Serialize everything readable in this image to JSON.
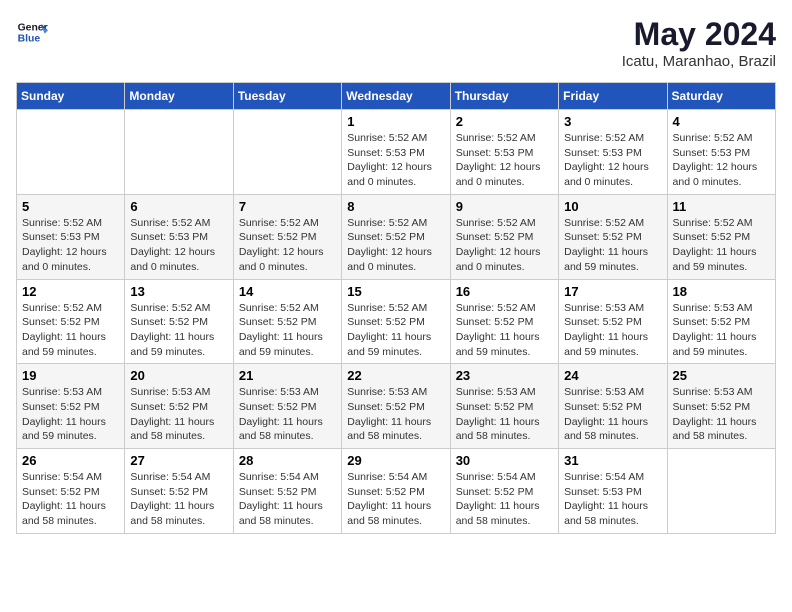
{
  "header": {
    "logo_line1": "General",
    "logo_line2": "Blue",
    "month_year": "May 2024",
    "location": "Icatu, Maranhao, Brazil"
  },
  "days_of_week": [
    "Sunday",
    "Monday",
    "Tuesday",
    "Wednesday",
    "Thursday",
    "Friday",
    "Saturday"
  ],
  "weeks": [
    [
      null,
      null,
      null,
      {
        "day": "1",
        "sunrise": "5:52 AM",
        "sunset": "5:53 PM",
        "daylight": "12 hours and 0 minutes."
      },
      {
        "day": "2",
        "sunrise": "5:52 AM",
        "sunset": "5:53 PM",
        "daylight": "12 hours and 0 minutes."
      },
      {
        "day": "3",
        "sunrise": "5:52 AM",
        "sunset": "5:53 PM",
        "daylight": "12 hours and 0 minutes."
      },
      {
        "day": "4",
        "sunrise": "5:52 AM",
        "sunset": "5:53 PM",
        "daylight": "12 hours and 0 minutes."
      }
    ],
    [
      {
        "day": "5",
        "sunrise": "5:52 AM",
        "sunset": "5:53 PM",
        "daylight": "12 hours and 0 minutes."
      },
      {
        "day": "6",
        "sunrise": "5:52 AM",
        "sunset": "5:53 PM",
        "daylight": "12 hours and 0 minutes."
      },
      {
        "day": "7",
        "sunrise": "5:52 AM",
        "sunset": "5:52 PM",
        "daylight": "12 hours and 0 minutes."
      },
      {
        "day": "8",
        "sunrise": "5:52 AM",
        "sunset": "5:52 PM",
        "daylight": "12 hours and 0 minutes."
      },
      {
        "day": "9",
        "sunrise": "5:52 AM",
        "sunset": "5:52 PM",
        "daylight": "12 hours and 0 minutes."
      },
      {
        "day": "10",
        "sunrise": "5:52 AM",
        "sunset": "5:52 PM",
        "daylight": "11 hours and 59 minutes."
      },
      {
        "day": "11",
        "sunrise": "5:52 AM",
        "sunset": "5:52 PM",
        "daylight": "11 hours and 59 minutes."
      }
    ],
    [
      {
        "day": "12",
        "sunrise": "5:52 AM",
        "sunset": "5:52 PM",
        "daylight": "11 hours and 59 minutes."
      },
      {
        "day": "13",
        "sunrise": "5:52 AM",
        "sunset": "5:52 PM",
        "daylight": "11 hours and 59 minutes."
      },
      {
        "day": "14",
        "sunrise": "5:52 AM",
        "sunset": "5:52 PM",
        "daylight": "11 hours and 59 minutes."
      },
      {
        "day": "15",
        "sunrise": "5:52 AM",
        "sunset": "5:52 PM",
        "daylight": "11 hours and 59 minutes."
      },
      {
        "day": "16",
        "sunrise": "5:52 AM",
        "sunset": "5:52 PM",
        "daylight": "11 hours and 59 minutes."
      },
      {
        "day": "17",
        "sunrise": "5:53 AM",
        "sunset": "5:52 PM",
        "daylight": "11 hours and 59 minutes."
      },
      {
        "day": "18",
        "sunrise": "5:53 AM",
        "sunset": "5:52 PM",
        "daylight": "11 hours and 59 minutes."
      }
    ],
    [
      {
        "day": "19",
        "sunrise": "5:53 AM",
        "sunset": "5:52 PM",
        "daylight": "11 hours and 59 minutes."
      },
      {
        "day": "20",
        "sunrise": "5:53 AM",
        "sunset": "5:52 PM",
        "daylight": "11 hours and 58 minutes."
      },
      {
        "day": "21",
        "sunrise": "5:53 AM",
        "sunset": "5:52 PM",
        "daylight": "11 hours and 58 minutes."
      },
      {
        "day": "22",
        "sunrise": "5:53 AM",
        "sunset": "5:52 PM",
        "daylight": "11 hours and 58 minutes."
      },
      {
        "day": "23",
        "sunrise": "5:53 AM",
        "sunset": "5:52 PM",
        "daylight": "11 hours and 58 minutes."
      },
      {
        "day": "24",
        "sunrise": "5:53 AM",
        "sunset": "5:52 PM",
        "daylight": "11 hours and 58 minutes."
      },
      {
        "day": "25",
        "sunrise": "5:53 AM",
        "sunset": "5:52 PM",
        "daylight": "11 hours and 58 minutes."
      }
    ],
    [
      {
        "day": "26",
        "sunrise": "5:54 AM",
        "sunset": "5:52 PM",
        "daylight": "11 hours and 58 minutes."
      },
      {
        "day": "27",
        "sunrise": "5:54 AM",
        "sunset": "5:52 PM",
        "daylight": "11 hours and 58 minutes."
      },
      {
        "day": "28",
        "sunrise": "5:54 AM",
        "sunset": "5:52 PM",
        "daylight": "11 hours and 58 minutes."
      },
      {
        "day": "29",
        "sunrise": "5:54 AM",
        "sunset": "5:52 PM",
        "daylight": "11 hours and 58 minutes."
      },
      {
        "day": "30",
        "sunrise": "5:54 AM",
        "sunset": "5:52 PM",
        "daylight": "11 hours and 58 minutes."
      },
      {
        "day": "31",
        "sunrise": "5:54 AM",
        "sunset": "5:53 PM",
        "daylight": "11 hours and 58 minutes."
      },
      null
    ]
  ],
  "labels": {
    "sunrise": "Sunrise:",
    "sunset": "Sunset:",
    "daylight": "Daylight:"
  }
}
